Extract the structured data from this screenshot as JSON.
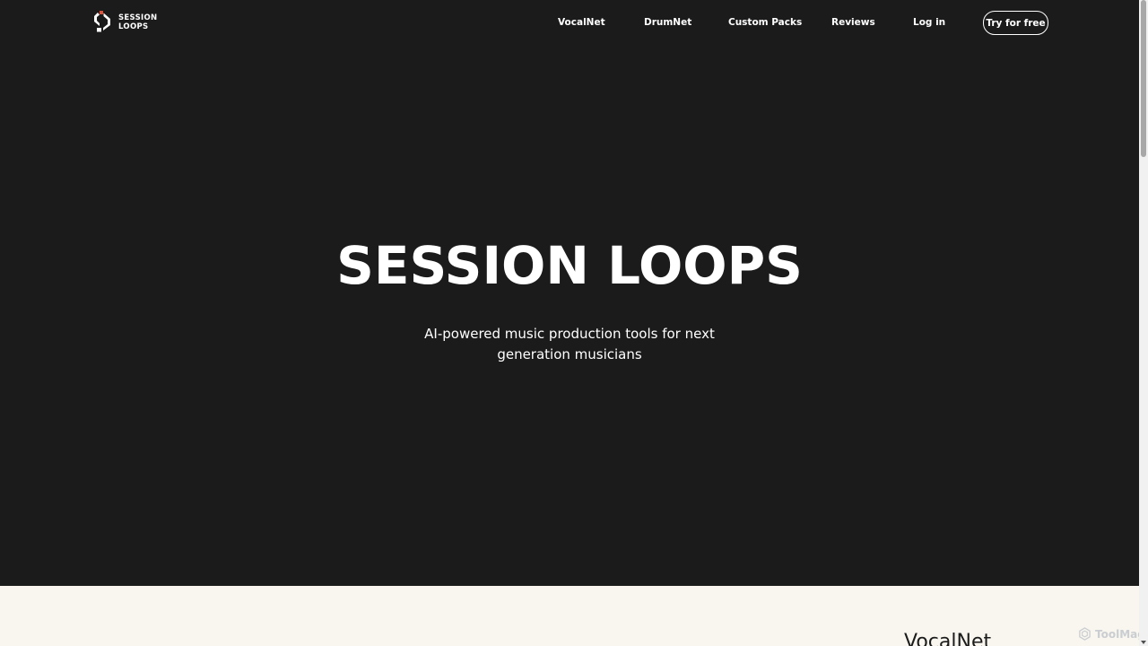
{
  "brand": {
    "line1": "SESSION",
    "line2": "LOOPS",
    "logo_icon": "session-loops-logo-icon",
    "accent": "#e0523a"
  },
  "nav": {
    "items": [
      {
        "label": "VocalNet"
      },
      {
        "label": "DrumNet"
      },
      {
        "label": "Custom Packs"
      },
      {
        "label": "Reviews"
      },
      {
        "label": "Log in"
      }
    ],
    "cta_label": "Try for free"
  },
  "hero": {
    "title": "SESSION LOOPS",
    "subtitle": "AI-powered music production tools for next generation musicians",
    "background": "#1b1b1b"
  },
  "next_section": {
    "heading": "VocalNet",
    "background": "#f8f6ee"
  },
  "watermark": {
    "text": "ToolMage",
    "icon": "toolmage-icon"
  }
}
